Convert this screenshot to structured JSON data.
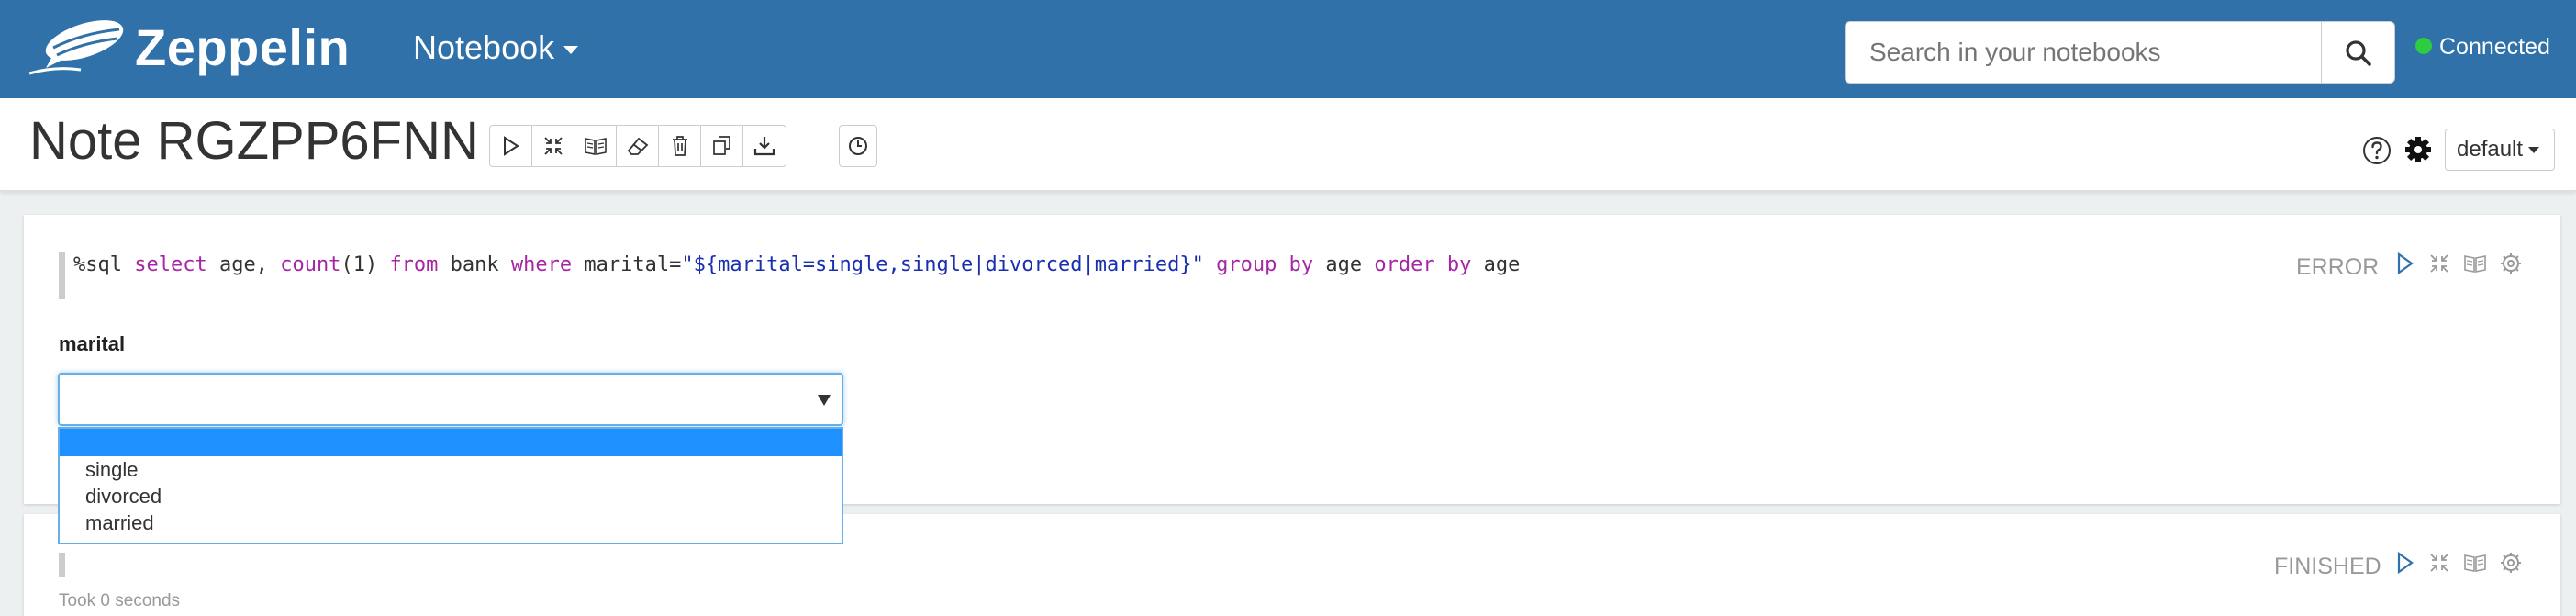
{
  "navbar": {
    "brand": "Zeppelin",
    "notebook_menu": "Notebook",
    "search_placeholder": "Search in your notebooks",
    "status": "Connected",
    "status_color": "#2ecc40"
  },
  "header": {
    "title": "Note RGZPP6FNN",
    "toolbar_icons": [
      "run-all-icon",
      "toggle-editor-icon",
      "toggle-output-icon",
      "clear-output-icon",
      "delete-icon",
      "clone-icon",
      "export-icon"
    ],
    "scheduler_icon": "clock-icon",
    "interpreter_binding": "default"
  },
  "paragraphs": [
    {
      "code": {
        "prefix": "%sql",
        "k1": "select",
        "t1": "age,",
        "f1": "count",
        "num": "1",
        "k2": "from",
        "t2": "bank",
        "k3": "where",
        "t3": "marital=",
        "str": "\"${marital=single,single|divorced|married}\"",
        "k4": "group by",
        "t4": "age",
        "k5": "order by",
        "t5": "age"
      },
      "status": "ERROR",
      "form": {
        "label": "marital",
        "selected": "",
        "options": [
          "",
          "single",
          "divorced",
          "married"
        ]
      }
    },
    {
      "status": "FINISHED",
      "took": "Took 0 seconds"
    }
  ],
  "colors": {
    "navbar": "#3071a9",
    "keyword": "#a626a4",
    "string": "#1a2fb0",
    "selected_option": "#1e90ff",
    "run_icon": "#3071a9"
  }
}
